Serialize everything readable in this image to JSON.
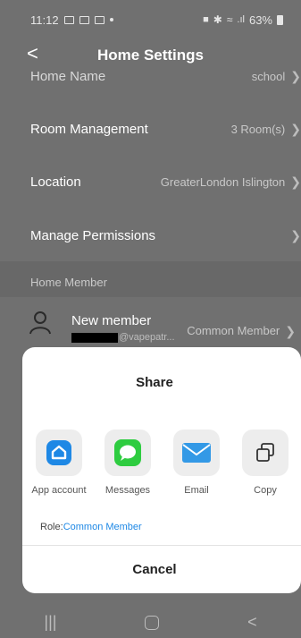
{
  "status_bar": {
    "time": "11:12",
    "battery": "63%"
  },
  "app_bar": {
    "title": "Home Settings",
    "back_label": "<"
  },
  "rows": {
    "home_name": {
      "label": "Home Name",
      "value": "school"
    },
    "room_management": {
      "label": "Room Management",
      "value": "3 Room(s)"
    },
    "location": {
      "label": "Location",
      "value": "GreaterLondon Islington"
    },
    "manage_permissions": {
      "label": "Manage Permissions"
    }
  },
  "home_member": {
    "section_title": "Home Member",
    "member": {
      "name": "New member",
      "email_suffix": "@vapepatr...",
      "role": "Common Member"
    }
  },
  "share_sheet": {
    "title": "Share",
    "items": [
      {
        "label": "App account",
        "icon": "home-app-icon",
        "color": "#1e88e5"
      },
      {
        "label": "Messages",
        "icon": "message-icon",
        "color": "#2ecc40"
      },
      {
        "label": "Email",
        "icon": "email-icon",
        "color": "#3399e6"
      },
      {
        "label": "Copy",
        "icon": "copy-icon",
        "color": "#333333"
      }
    ],
    "role_prefix": "Role:",
    "role_value": "Common Member",
    "cancel_label": "Cancel"
  },
  "nav_bar": {
    "recents": "|||",
    "back": "<"
  }
}
